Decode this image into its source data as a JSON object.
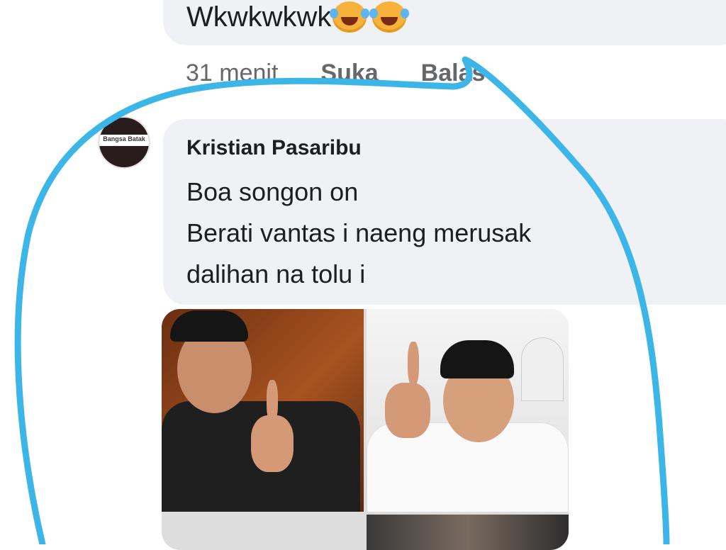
{
  "previous_comment": {
    "text": "Wkwkwkwk",
    "emojis": [
      "laughing-tears-emoji",
      "laughing-tears-emoji"
    ]
  },
  "actions": {
    "time": "31 menit",
    "like": "Suka",
    "reply": "Balas"
  },
  "comment": {
    "author": "Kristian Pasaribu",
    "lines": [
      "Boa songon on",
      "Berati vantas i naeng merusak",
      "dalihan na tolu i"
    ],
    "avatar_text": "Bangsa Batak"
  },
  "colors": {
    "bubble": "#eff1f4",
    "meta_text": "#65676b",
    "annotation": "#3cb6e8"
  }
}
